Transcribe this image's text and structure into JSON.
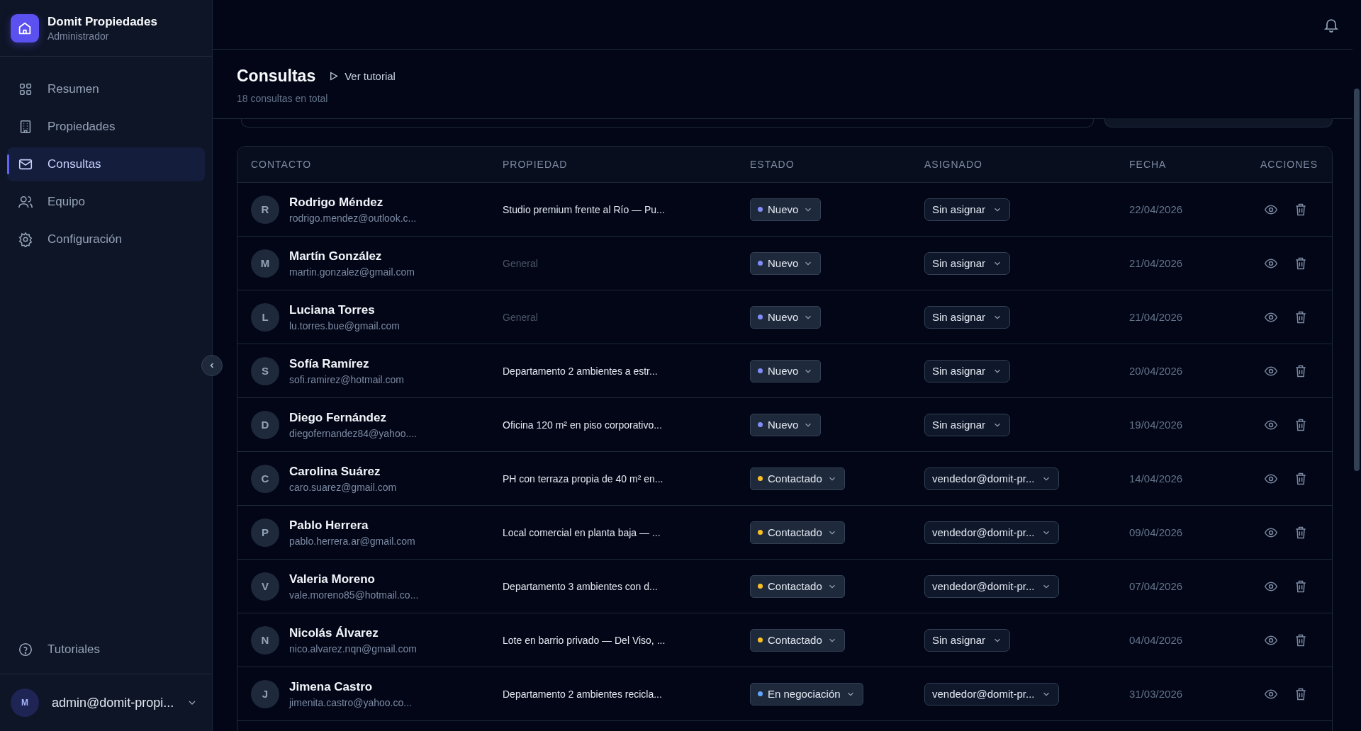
{
  "sidebar": {
    "brand": {
      "name": "Domit Propiedades",
      "role": "Administrador"
    },
    "items": [
      {
        "label": "Resumen",
        "selected": false
      },
      {
        "label": "Propiedades",
        "selected": false
      },
      {
        "label": "Consultas",
        "selected": true
      },
      {
        "label": "Equipo",
        "selected": false
      },
      {
        "label": "Configuración",
        "selected": false
      }
    ],
    "help": {
      "label": "Tutoriales"
    },
    "user": {
      "initial": "M",
      "email": "admin@domit-propi..."
    }
  },
  "page": {
    "title": "Consultas",
    "tutorial_link": "Ver tutorial",
    "subtitle": "18 consultas en total"
  },
  "table": {
    "columns": [
      "CONTACTO",
      "PROPIEDAD",
      "ESTADO",
      "ASIGNADO",
      "FECHA",
      "ACCIONES"
    ],
    "rows": [
      {
        "initial": "R",
        "name": "Rodrigo Méndez",
        "email": "rodrigo.mendez@outlook.c...",
        "property": "Studio premium frente al Río — Pu...",
        "property_muted": false,
        "status": {
          "label": "Nuevo",
          "color": "#818cf8"
        },
        "assigned": "Sin asignar",
        "date": "22/04/2026"
      },
      {
        "initial": "M",
        "name": "Martín González",
        "email": "martin.gonzalez@gmail.com",
        "property": "General",
        "property_muted": true,
        "status": {
          "label": "Nuevo",
          "color": "#818cf8"
        },
        "assigned": "Sin asignar",
        "date": "21/04/2026"
      },
      {
        "initial": "L",
        "name": "Luciana Torres",
        "email": "lu.torres.bue@gmail.com",
        "property": "General",
        "property_muted": true,
        "status": {
          "label": "Nuevo",
          "color": "#818cf8"
        },
        "assigned": "Sin asignar",
        "date": "21/04/2026"
      },
      {
        "initial": "S",
        "name": "Sofía Ramírez",
        "email": "sofi.ramirez@hotmail.com",
        "property": "Departamento 2 ambientes a estr...",
        "property_muted": false,
        "status": {
          "label": "Nuevo",
          "color": "#818cf8"
        },
        "assigned": "Sin asignar",
        "date": "20/04/2026"
      },
      {
        "initial": "D",
        "name": "Diego Fernández",
        "email": "diegofernandez84@yahoo....",
        "property": "Oficina 120 m² en piso corporativo...",
        "property_muted": false,
        "status": {
          "label": "Nuevo",
          "color": "#818cf8"
        },
        "assigned": "Sin asignar",
        "date": "19/04/2026"
      },
      {
        "initial": "C",
        "name": "Carolina Suárez",
        "email": "caro.suarez@gmail.com",
        "property": "PH con terraza propia de 40 m² en...",
        "property_muted": false,
        "status": {
          "label": "Contactado",
          "color": "#fbbf24"
        },
        "assigned": "vendedor@domit-pr...",
        "date": "14/04/2026"
      },
      {
        "initial": "P",
        "name": "Pablo Herrera",
        "email": "pablo.herrera.ar@gmail.com",
        "property": "Local comercial en planta baja — ...",
        "property_muted": false,
        "status": {
          "label": "Contactado",
          "color": "#fbbf24"
        },
        "assigned": "vendedor@domit-pr...",
        "date": "09/04/2026"
      },
      {
        "initial": "V",
        "name": "Valeria Moreno",
        "email": "vale.moreno85@hotmail.co...",
        "property": "Departamento 3 ambientes con d...",
        "property_muted": false,
        "status": {
          "label": "Contactado",
          "color": "#fbbf24"
        },
        "assigned": "vendedor@domit-pr...",
        "date": "07/04/2026"
      },
      {
        "initial": "N",
        "name": "Nicolás Álvarez",
        "email": "nico.alvarez.nqn@gmail.com",
        "property": "Lote en barrio privado — Del Viso, ...",
        "property_muted": false,
        "status": {
          "label": "Contactado",
          "color": "#fbbf24"
        },
        "assigned": "Sin asignar",
        "date": "04/04/2026"
      },
      {
        "initial": "J",
        "name": "Jimena Castro",
        "email": "jimenita.castro@yahoo.co...",
        "property": "Departamento 2 ambientes recicla...",
        "property_muted": false,
        "status": {
          "label": "En negociación",
          "color": "#60a5fa"
        },
        "assigned": "vendedor@domit-pr...",
        "date": "31/03/2026"
      }
    ]
  }
}
